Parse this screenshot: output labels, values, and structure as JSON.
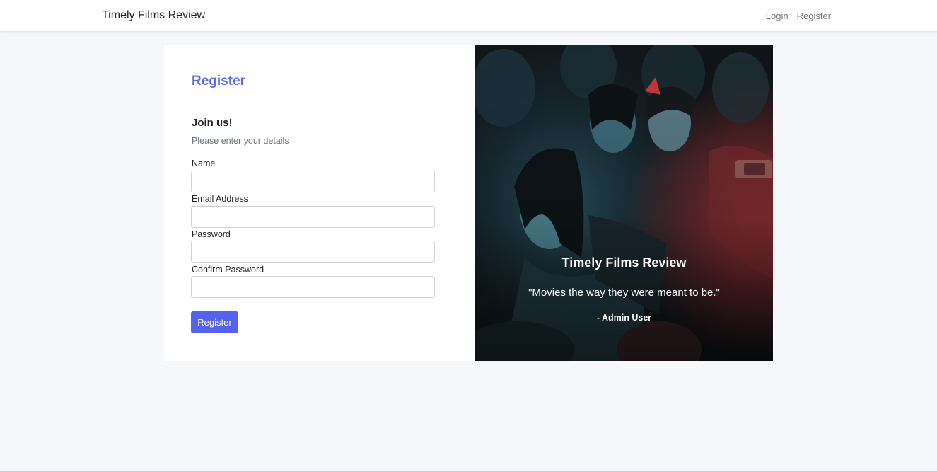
{
  "navbar": {
    "brand": "Timely Films Review",
    "links": [
      {
        "label": "Login"
      },
      {
        "label": "Register"
      }
    ]
  },
  "form": {
    "title": "Register",
    "heading": "Join us!",
    "subheading": "Please enter your details",
    "fields": [
      {
        "label": "Name",
        "value": "",
        "placeholder": ""
      },
      {
        "label": "Email Address",
        "value": "",
        "placeholder": ""
      },
      {
        "label": "Password",
        "value": "",
        "placeholder": ""
      },
      {
        "label": "Confirm Password",
        "value": "",
        "placeholder": ""
      }
    ],
    "submit_label": "Register"
  },
  "hero": {
    "title": "Timely Films Review",
    "quote": "\"Movies the way they were meant to be.\"",
    "author": "- Admin User"
  },
  "colors": {
    "accent": "#5462ee",
    "title_accent": "#5b6be0",
    "background": "#f5f7fa"
  }
}
